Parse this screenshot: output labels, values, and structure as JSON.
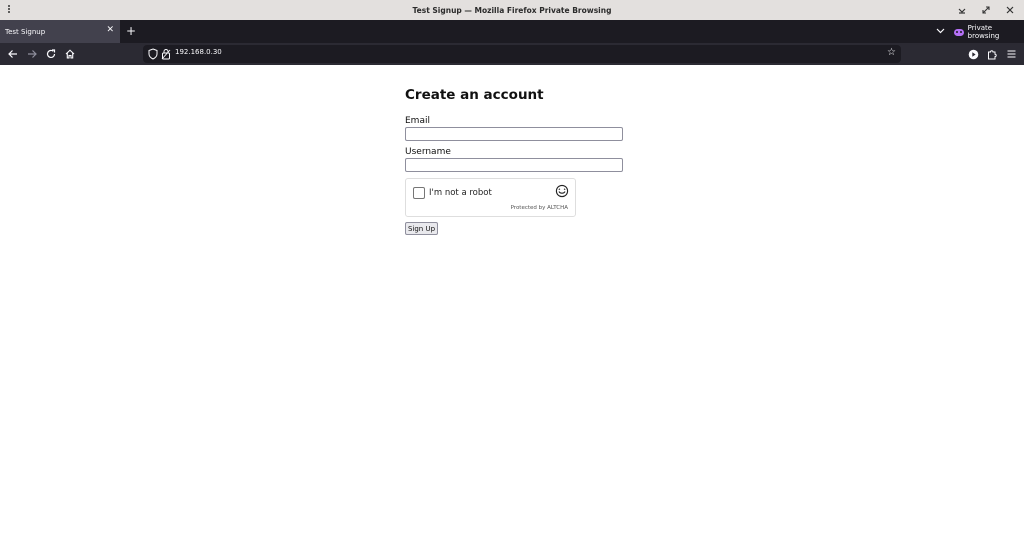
{
  "window": {
    "title": "Test Signup — Mozilla Firefox Private Browsing"
  },
  "tabs": [
    {
      "label": "Test Signup",
      "active": true
    }
  ],
  "private_badge": {
    "label": "Private browsing",
    "accent": "#b470f5"
  },
  "navbar": {
    "url": "192.168.0.30"
  },
  "page": {
    "title": "Create an account",
    "email": {
      "label": "Email",
      "value": ""
    },
    "username": {
      "label": "Username",
      "value": ""
    },
    "captcha": {
      "label": "I'm not a robot",
      "footer": "Protected by ALTCHA",
      "checked": false
    },
    "submit_label": "Sign Up"
  },
  "colors": {
    "titlebar_bg": "#e3e0de",
    "tabstrip_bg": "#1c1b22",
    "tab_active_bg": "#42414d",
    "navbar_bg": "#2b2a33",
    "urlbar_bg": "#1c1b22"
  }
}
